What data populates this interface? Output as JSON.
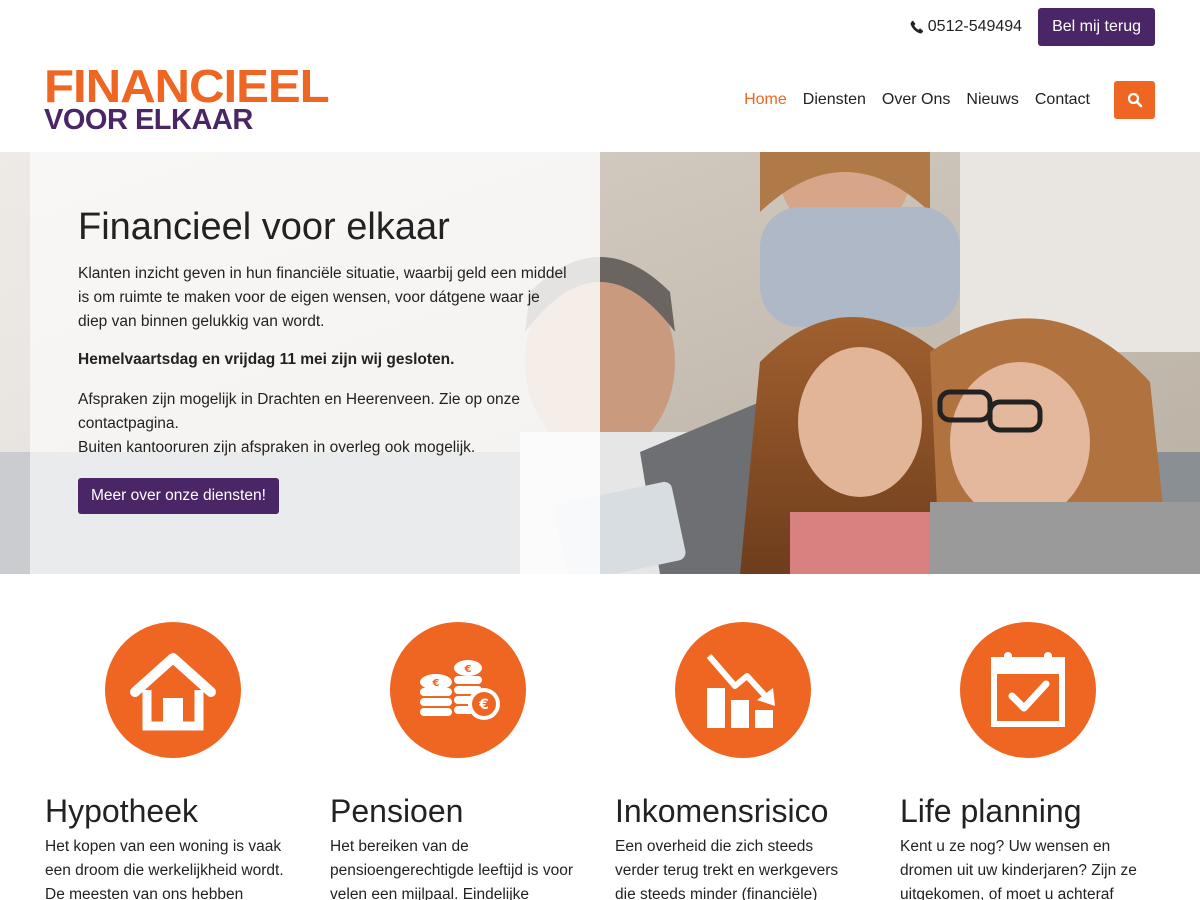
{
  "topbar": {
    "phone": "0512-549494",
    "callback_label": "Bel mij terug"
  },
  "logo": {
    "line1": "FINANCIEEL",
    "line2": "VOOR ELKAAR"
  },
  "nav": {
    "items": [
      "Home",
      "Diensten",
      "Over Ons",
      "Nieuws",
      "Contact"
    ],
    "active": "Home"
  },
  "hero": {
    "title": "Financieel voor elkaar",
    "intro": "Klanten inzicht geven in hun financiële situatie, waarbij geld een middel is om ruimte te maken voor de eigen wensen, voor dátgene waar je diep van binnen gelukkig van wordt.",
    "notice": "Hemelvaartsdag en vrijdag 11 mei zijn wij gesloten.",
    "appointments_line1": "Afspraken zijn mogelijk in Drachten en Heerenveen. Zie op onze contactpagina.",
    "appointments_line2": "Buiten kantooruren zijn afspraken in overleg ook mogelijk.",
    "cta_label": "Meer over onze diensten!"
  },
  "services": [
    {
      "icon": "house-icon",
      "title": "Hypotheek",
      "text": "Het kopen van een woning is vaak een droom die werkelijkheid wordt. De meesten van ons hebben"
    },
    {
      "icon": "euro-coins-icon",
      "title": "Pensioen",
      "text": "Het bereiken van de pensioengerechtigde leeftijd is voor velen een mijlpaal. Eindelijke"
    },
    {
      "icon": "declining-chart-icon",
      "title": "Inkomensrisico",
      "text": "Een overheid die zich steeds verder terug trekt en werkgevers die steeds minder (financiële) ruimtes"
    },
    {
      "icon": "calendar-check-icon",
      "title": "Life planning",
      "text": "Kent u ze nog? Uw wensen en dromen uit uw kinderjaren? Zijn ze uitgekomen, of moet u achteraf"
    }
  ],
  "colors": {
    "orange": "#ef6522",
    "purple": "#4b2666"
  }
}
